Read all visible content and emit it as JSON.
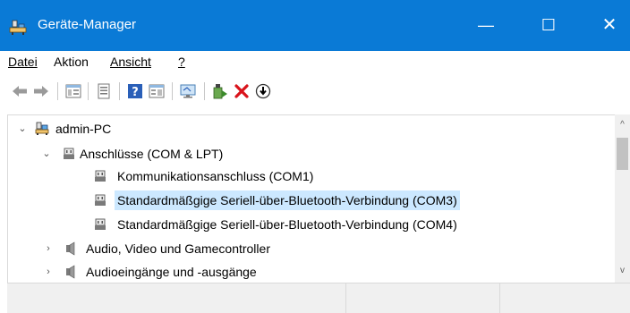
{
  "window": {
    "title": "Geräte-Manager",
    "accent_color": "#0a7ad6",
    "controls": {
      "minimize": "—",
      "maximize": "☐",
      "close": "✕"
    }
  },
  "menubar": {
    "items": [
      {
        "label": "Datei"
      },
      {
        "label": "Aktion"
      },
      {
        "label": "Ansicht"
      },
      {
        "label": "?"
      }
    ]
  },
  "toolbar": {
    "buttons": [
      {
        "icon": "back-arrow-icon"
      },
      {
        "icon": "forward-arrow-icon"
      },
      {
        "icon": "show-hide-console-tree-icon"
      },
      {
        "icon": "properties-icon"
      },
      {
        "icon": "help-icon"
      },
      {
        "icon": "action-pane-icon"
      },
      {
        "icon": "scan-hardware-icon"
      },
      {
        "icon": "update-driver-icon"
      },
      {
        "icon": "uninstall-device-icon"
      },
      {
        "icon": "disable-device-icon"
      }
    ]
  },
  "tree": {
    "selection_color": "#cce8ff",
    "nodes": [
      {
        "label": "admin-PC",
        "level": 0,
        "expander": "expanded",
        "icon": "computer-icon"
      },
      {
        "label": "Anschlüsse (COM & LPT)",
        "level": 1,
        "expander": "expanded",
        "icon": "port-icon"
      },
      {
        "label": "Kommunikationsanschluss (COM1)",
        "level": 2,
        "expander": "none",
        "icon": "port-icon"
      },
      {
        "label": "Standardmäßgige Seriell-über-Bluetooth-Verbindung (COM3)",
        "level": 2,
        "expander": "none",
        "icon": "port-icon",
        "selected": true
      },
      {
        "label": "Standardmäßgige Seriell-über-Bluetooth-Verbindung (COM4)",
        "level": 2,
        "expander": "none",
        "icon": "port-icon"
      },
      {
        "label": "Audio, Video und Gamecontroller",
        "level": 1,
        "expander": "collapsed",
        "icon": "speaker-icon"
      },
      {
        "label": "Audioeingänge und -ausgänge",
        "level": 1,
        "expander": "collapsed",
        "icon": "speaker-icon"
      }
    ]
  },
  "scrollbar": {
    "up_glyph": "^",
    "down_glyph": "v"
  }
}
